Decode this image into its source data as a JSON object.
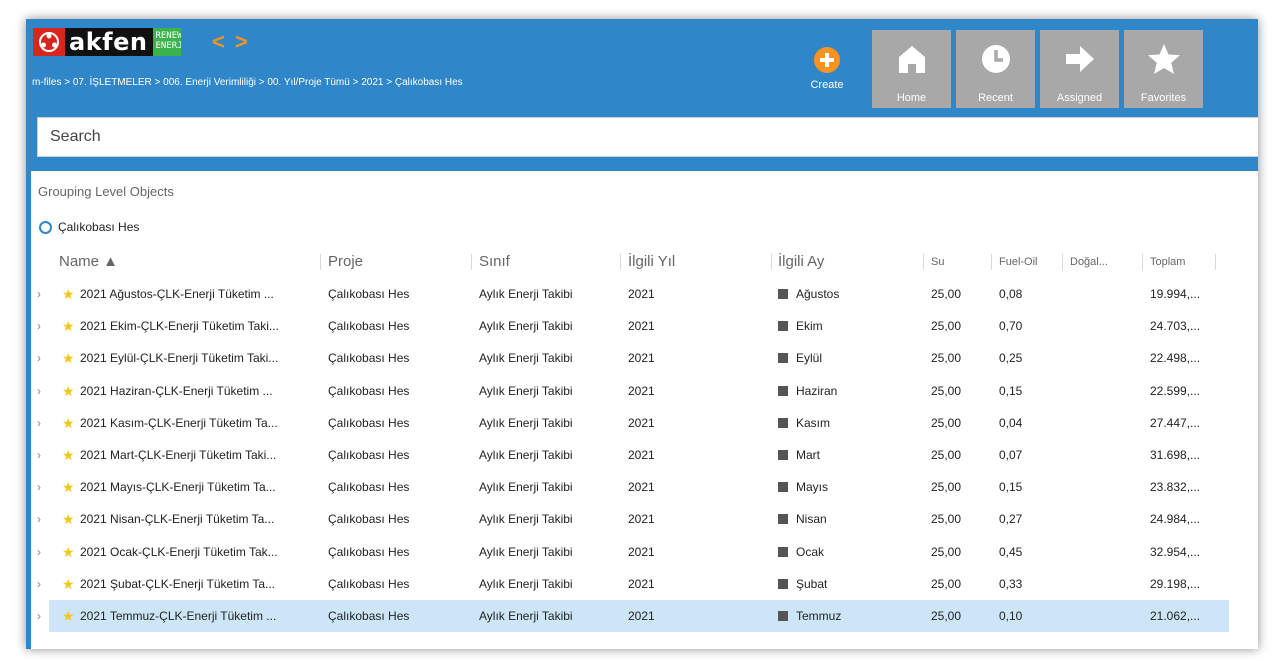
{
  "header": {
    "logo_text": "akfen",
    "logo_sub_line1": "RENEW",
    "logo_sub_line2": "ENERJ",
    "breadcrumb": "m-files > 07. İŞLETMELER > 006. Enerji Verimliliği > 00. Yıl/Proje Tümü > 2021 > Çalıkobası Hes",
    "back_glyph": "<",
    "forward_glyph": ">",
    "create_label": "Create",
    "tabs": [
      {
        "label": "Home",
        "icon": "home-icon"
      },
      {
        "label": "Recent",
        "icon": "clock-icon"
      },
      {
        "label": "Assigned",
        "icon": "arrow-right-icon"
      },
      {
        "label": "Favorites",
        "icon": "star-icon"
      }
    ],
    "colors": {
      "header_bg": "#2f86c8",
      "accent": "#f7931e",
      "tab_bg": "#a8a8a8"
    }
  },
  "search": {
    "placeholder": "Search"
  },
  "list": {
    "group_title": "Grouping Level Objects",
    "group_node": "Çalıkobası Hes",
    "columns": {
      "name": "Name ▲",
      "proje": "Proje",
      "sinif": "Sınıf",
      "ilgili_yil": "İlgili Yıl",
      "ilgili_ay": "İlgili Ay",
      "su": "Su",
      "fuel_oil": "Fuel-Oil",
      "dogal": "Doğal...",
      "toplam": "Toplam"
    },
    "rows": [
      {
        "name": "2021 Ağustos-ÇLK-Enerji Tüketim ...",
        "proje": "Çalıkobası Hes",
        "sinif": "Aylık Enerji Takibi",
        "yil": "2021",
        "ay": "Ağustos",
        "su": "25,00",
        "fuel_oil": "0,08",
        "toplam": "19.994,..."
      },
      {
        "name": "2021 Ekim-ÇLK-Enerji Tüketim Taki...",
        "proje": "Çalıkobası Hes",
        "sinif": "Aylık Enerji Takibi",
        "yil": "2021",
        "ay": "Ekim",
        "su": "25,00",
        "fuel_oil": "0,70",
        "toplam": "24.703,..."
      },
      {
        "name": "2021 Eylül-ÇLK-Enerji Tüketim Taki...",
        "proje": "Çalıkobası Hes",
        "sinif": "Aylık Enerji Takibi",
        "yil": "2021",
        "ay": "Eylül",
        "su": "25,00",
        "fuel_oil": "0,25",
        "toplam": "22.498,..."
      },
      {
        "name": "2021 Haziran-ÇLK-Enerji Tüketim ...",
        "proje": "Çalıkobası Hes",
        "sinif": "Aylık Enerji Takibi",
        "yil": "2021",
        "ay": "Haziran",
        "su": "25,00",
        "fuel_oil": "0,15",
        "toplam": "22.599,..."
      },
      {
        "name": "2021 Kasım-ÇLK-Enerji Tüketim Ta...",
        "proje": "Çalıkobası Hes",
        "sinif": "Aylık Enerji Takibi",
        "yil": "2021",
        "ay": "Kasım",
        "su": "25,00",
        "fuel_oil": "0,04",
        "toplam": "27.447,..."
      },
      {
        "name": "2021 Mart-ÇLK-Enerji Tüketim Taki...",
        "proje": "Çalıkobası Hes",
        "sinif": "Aylık Enerji Takibi",
        "yil": "2021",
        "ay": "Mart",
        "su": "25,00",
        "fuel_oil": "0,07",
        "toplam": "31.698,..."
      },
      {
        "name": "2021 Mayıs-ÇLK-Enerji Tüketim Ta...",
        "proje": "Çalıkobası Hes",
        "sinif": "Aylık Enerji Takibi",
        "yil": "2021",
        "ay": "Mayıs",
        "su": "25,00",
        "fuel_oil": "0,15",
        "toplam": "23.832,..."
      },
      {
        "name": "2021 Nisan-ÇLK-Enerji Tüketim Ta...",
        "proje": "Çalıkobası Hes",
        "sinif": "Aylık Enerji Takibi",
        "yil": "2021",
        "ay": "Nisan",
        "su": "25,00",
        "fuel_oil": "0,27",
        "toplam": "24.984,..."
      },
      {
        "name": "2021 Ocak-ÇLK-Enerji Tüketim Tak...",
        "proje": "Çalıkobası Hes",
        "sinif": "Aylık Enerji Takibi",
        "yil": "2021",
        "ay": "Ocak",
        "su": "25,00",
        "fuel_oil": "0,45",
        "toplam": "32.954,..."
      },
      {
        "name": "2021 Şubat-ÇLK-Enerji Tüketim Ta...",
        "proje": "Çalıkobası Hes",
        "sinif": "Aylık Enerji Takibi",
        "yil": "2021",
        "ay": "Şubat",
        "su": "25,00",
        "fuel_oil": "0,33",
        "toplam": "29.198,..."
      },
      {
        "name": "2021 Temmuz-ÇLK-Enerji Tüketim ...",
        "proje": "Çalıkobası Hes",
        "sinif": "Aylık Enerji Takibi",
        "yil": "2021",
        "ay": "Temmuz",
        "su": "25,00",
        "fuel_oil": "0,10",
        "toplam": "21.062,...",
        "selected": true
      }
    ]
  }
}
